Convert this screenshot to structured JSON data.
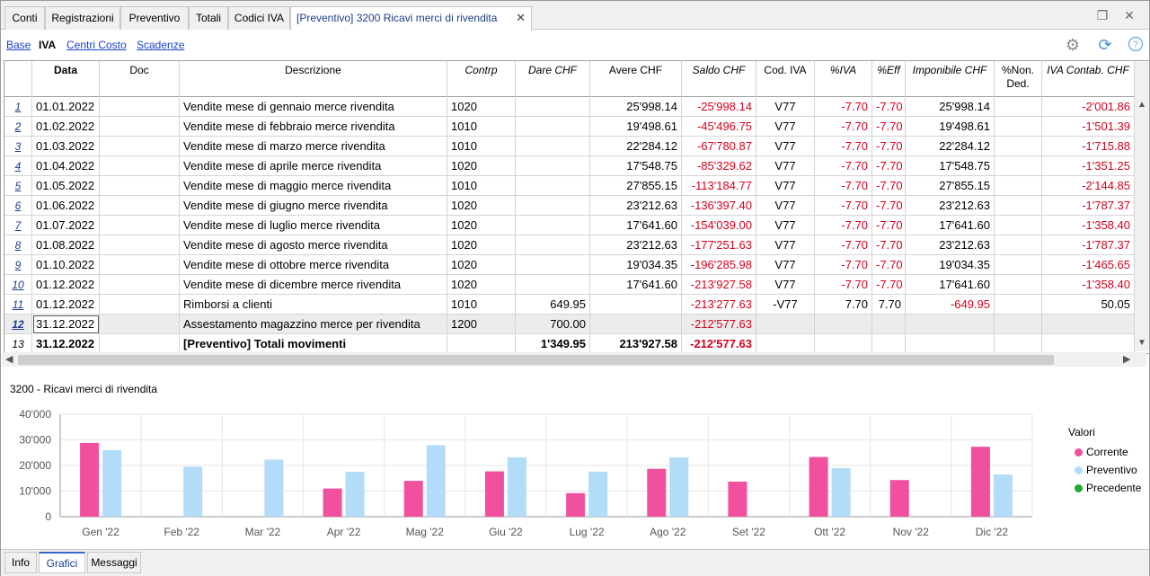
{
  "tabs": [
    "Conti",
    "Registrazioni",
    "Preventivo",
    "Totali",
    "Codici IVA",
    "[Preventivo] 3200 Ricavi merci di rivendita"
  ],
  "views": {
    "base": "Base",
    "iva": "IVA",
    "centri": "Centri Costo",
    "scadenze": "Scadenze"
  },
  "columns": [
    "Data",
    "Doc",
    "Descrizione",
    "Contrp",
    "Dare CHF",
    "Avere CHF",
    "Saldo CHF",
    "Cod. IVA",
    "%IVA",
    "%Eff",
    "Imponibile CHF",
    "%Non.\nDed.",
    "IVA Contab. CHF"
  ],
  "rows": [
    {
      "n": "1",
      "data": "01.01.2022",
      "doc": "",
      "desc": "Vendite mese di gennaio merce rivendita",
      "contrp": "1020",
      "dare": "",
      "avere": "25'998.14",
      "saldo": "-25'998.14",
      "cod": "V77",
      "iva": "-7.70",
      "eff": "-7.70",
      "imp": "25'998.14",
      "nonded": "",
      "ivacont": "-2'001.86"
    },
    {
      "n": "2",
      "data": "01.02.2022",
      "doc": "",
      "desc": "Vendite mese di febbraio merce rivendita",
      "contrp": "1010",
      "dare": "",
      "avere": "19'498.61",
      "saldo": "-45'496.75",
      "cod": "V77",
      "iva": "-7.70",
      "eff": "-7.70",
      "imp": "19'498.61",
      "nonded": "",
      "ivacont": "-1'501.39"
    },
    {
      "n": "3",
      "data": "01.03.2022",
      "doc": "",
      "desc": "Vendite mese di marzo merce rivendita",
      "contrp": "1010",
      "dare": "",
      "avere": "22'284.12",
      "saldo": "-67'780.87",
      "cod": "V77",
      "iva": "-7.70",
      "eff": "-7.70",
      "imp": "22'284.12",
      "nonded": "",
      "ivacont": "-1'715.88"
    },
    {
      "n": "4",
      "data": "01.04.2022",
      "doc": "",
      "desc": "Vendite mese di aprile merce rivendita",
      "contrp": "1020",
      "dare": "",
      "avere": "17'548.75",
      "saldo": "-85'329.62",
      "cod": "V77",
      "iva": "-7.70",
      "eff": "-7.70",
      "imp": "17'548.75",
      "nonded": "",
      "ivacont": "-1'351.25"
    },
    {
      "n": "5",
      "data": "01.05.2022",
      "doc": "",
      "desc": "Vendite mese di maggio merce rivendita",
      "contrp": "1010",
      "dare": "",
      "avere": "27'855.15",
      "saldo": "-113'184.77",
      "cod": "V77",
      "iva": "-7.70",
      "eff": "-7.70",
      "imp": "27'855.15",
      "nonded": "",
      "ivacont": "-2'144.85"
    },
    {
      "n": "6",
      "data": "01.06.2022",
      "doc": "",
      "desc": "Vendite mese di giugno merce rivendita",
      "contrp": "1020",
      "dare": "",
      "avere": "23'212.63",
      "saldo": "-136'397.40",
      "cod": "V77",
      "iva": "-7.70",
      "eff": "-7.70",
      "imp": "23'212.63",
      "nonded": "",
      "ivacont": "-1'787.37"
    },
    {
      "n": "7",
      "data": "01.07.2022",
      "doc": "",
      "desc": "Vendite mese di luglio merce rivendita",
      "contrp": "1020",
      "dare": "",
      "avere": "17'641.60",
      "saldo": "-154'039.00",
      "cod": "V77",
      "iva": "-7.70",
      "eff": "-7.70",
      "imp": "17'641.60",
      "nonded": "",
      "ivacont": "-1'358.40"
    },
    {
      "n": "8",
      "data": "01.08.2022",
      "doc": "",
      "desc": "Vendite mese di agosto merce rivendita",
      "contrp": "1020",
      "dare": "",
      "avere": "23'212.63",
      "saldo": "-177'251.63",
      "cod": "V77",
      "iva": "-7.70",
      "eff": "-7.70",
      "imp": "23'212.63",
      "nonded": "",
      "ivacont": "-1'787.37"
    },
    {
      "n": "9",
      "data": "01.10.2022",
      "doc": "",
      "desc": "Vendite mese di ottobre merce rivendita",
      "contrp": "1020",
      "dare": "",
      "avere": "19'034.35",
      "saldo": "-196'285.98",
      "cod": "V77",
      "iva": "-7.70",
      "eff": "-7.70",
      "imp": "19'034.35",
      "nonded": "",
      "ivacont": "-1'465.65"
    },
    {
      "n": "10",
      "data": "01.12.2022",
      "doc": "",
      "desc": "Vendite mese di dicembre merce rivendita",
      "contrp": "1020",
      "dare": "",
      "avere": "17'641.60",
      "saldo": "-213'927.58",
      "cod": "V77",
      "iva": "-7.70",
      "eff": "-7.70",
      "imp": "17'641.60",
      "nonded": "",
      "ivacont": "-1'358.40"
    },
    {
      "n": "11",
      "data": "01.12.2022",
      "doc": "",
      "desc": "Rimborsi a clienti",
      "contrp": "1010",
      "dare": "649.95",
      "avere": "",
      "saldo": "-213'277.63",
      "cod": "-V77",
      "iva": "7.70",
      "eff": "7.70",
      "imp": "-649.95",
      "nonded": "",
      "ivacont": "50.05"
    },
    {
      "n": "12",
      "data": "31.12.2022",
      "doc": "",
      "desc": "Assestamento magazzino merce per rivendita",
      "contrp": "1200",
      "dare": "700.00",
      "avere": "",
      "saldo": "-212'577.63",
      "cod": "",
      "iva": "",
      "eff": "",
      "imp": "",
      "nonded": "",
      "ivacont": ""
    },
    {
      "n": "13",
      "data": "31.12.2022",
      "doc": "",
      "desc": "[Preventivo] Totali movimenti",
      "contrp": "",
      "dare": "1'349.95",
      "avere": "213'927.58",
      "saldo": "-212'577.63",
      "cod": "",
      "iva": "",
      "eff": "",
      "imp": "",
      "nonded": "",
      "ivacont": ""
    }
  ],
  "chart_title": "3200 - Ricavi merci di rivendita",
  "chart_data": {
    "type": "bar",
    "categories": [
      "Gen '22",
      "Feb '22",
      "Mar '22",
      "Apr '22",
      "Mag '22",
      "Giu '22",
      "Lug '22",
      "Ago '22",
      "Set '22",
      "Ott '22",
      "Nov '22",
      "Dic '22"
    ],
    "series": [
      {
        "name": "Corrente",
        "color": "#f0509e",
        "values": [
          28800,
          0,
          0,
          11000,
          14000,
          17700,
          9200,
          18700,
          13700,
          23300,
          14300,
          27300
        ]
      },
      {
        "name": "Preventivo",
        "color": "#b3dcf8",
        "values": [
          26000,
          19500,
          22300,
          17500,
          27900,
          23200,
          17600,
          23200,
          0,
          19000,
          0,
          16500
        ]
      },
      {
        "name": "Precedente",
        "color": "#1fa832",
        "values": [
          0,
          0,
          0,
          0,
          0,
          0,
          0,
          0,
          0,
          0,
          0,
          0
        ]
      }
    ],
    "yticks": [
      "0",
      "10'000",
      "20'000",
      "30'000",
      "40'000"
    ],
    "ylim": [
      0,
      40000
    ],
    "legend_title": "Valori",
    "grid": true,
    "legend_position": "right"
  },
  "bottom_tabs": [
    "Info",
    "Grafici",
    "Messaggi"
  ]
}
